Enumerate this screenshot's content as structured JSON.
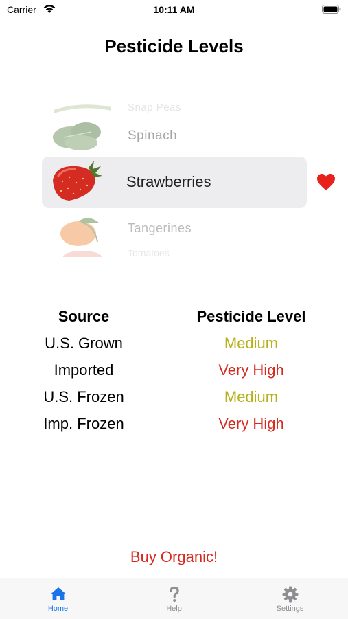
{
  "status_bar": {
    "carrier": "Carrier",
    "time": "10:11 AM"
  },
  "title": "Pesticide Levels",
  "picker": {
    "items": [
      {
        "label": "Snap Peas",
        "icon": "snap-peas-image"
      },
      {
        "label": "Spinach",
        "icon": "spinach-image"
      },
      {
        "label": "Strawberries",
        "icon": "strawberry-image",
        "selected": true,
        "favorite": true
      },
      {
        "label": "Tangerines",
        "icon": "tangerine-image"
      },
      {
        "label": "Tomatoes",
        "icon": "tomato-image"
      }
    ]
  },
  "favorite": {
    "icon": "heart-icon",
    "color": "#e8211a"
  },
  "levels_table": {
    "headers": {
      "source": "Source",
      "level": "Pesticide Level"
    },
    "rows": [
      {
        "source": "U.S. Grown",
        "level": "Medium"
      },
      {
        "source": "Imported",
        "level": "Very High"
      },
      {
        "source": "U.S. Frozen",
        "level": "Medium"
      },
      {
        "source": "Imp. Frozen",
        "level": "Very High"
      }
    ],
    "colors": {
      "Medium": "#b7b01a",
      "Very High": "#d62a1f"
    }
  },
  "recommendation": "Buy Organic!",
  "tabs": [
    {
      "label": "Home",
      "icon": "house-icon",
      "active": true
    },
    {
      "label": "Help",
      "icon": "question-mark-icon",
      "active": false
    },
    {
      "label": "Settings",
      "icon": "gear-icon",
      "active": false
    }
  ],
  "accent_color": "#1a73e8"
}
